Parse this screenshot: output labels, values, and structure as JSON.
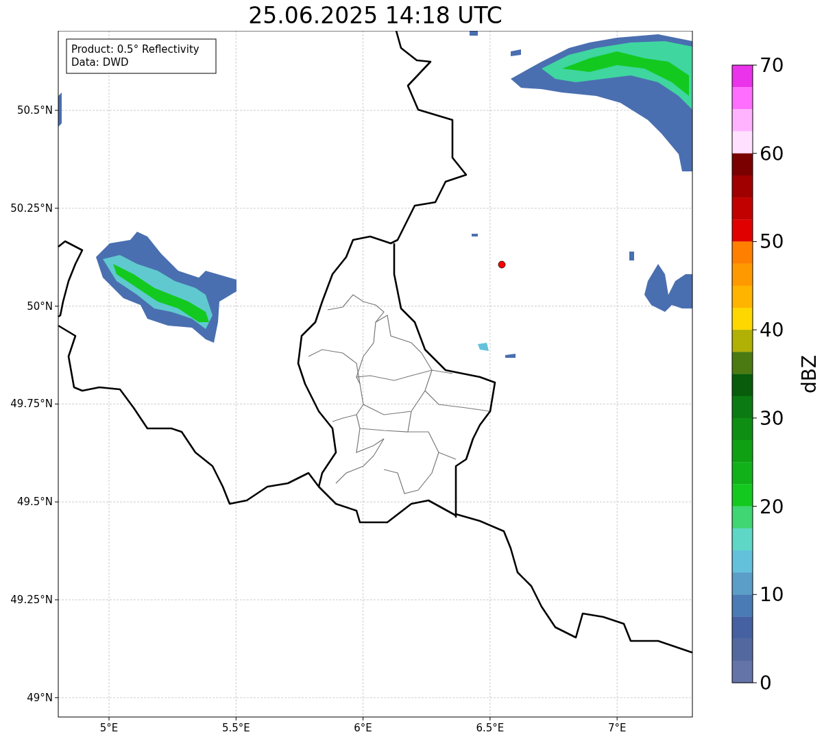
{
  "title": "25.06.2025 14:18 UTC",
  "info_box": {
    "lines": [
      "Product: 0.5° Reflectivity",
      "Data: DWD"
    ]
  },
  "x_ticks": [
    "5°E",
    "5.5°E",
    "6°E",
    "6.5°E",
    "7°E"
  ],
  "y_ticks": [
    "50.5°N",
    "50.25°N",
    "50°N",
    "49.75°N",
    "49.5°N",
    "49.25°N",
    "49°N"
  ],
  "colorbar": {
    "label": "dBZ",
    "ticks": [
      "70",
      "60",
      "50",
      "40",
      "30",
      "20",
      "10",
      "0"
    ],
    "bins": [
      {
        "color": "#ea33ea"
      },
      {
        "color": "#ff6eff"
      },
      {
        "color": "#ffb3ff"
      },
      {
        "color": "#ffe1ff"
      },
      {
        "color": "#7a0000"
      },
      {
        "color": "#a00000"
      },
      {
        "color": "#c10000"
      },
      {
        "color": "#e00000"
      },
      {
        "color": "#ff7f00"
      },
      {
        "color": "#ff9900"
      },
      {
        "color": "#ffb400"
      },
      {
        "color": "#ffd700"
      },
      {
        "color": "#b0b005"
      },
      {
        "color": "#4c7a12"
      },
      {
        "color": "#085c0b"
      },
      {
        "color": "#0c7a12"
      },
      {
        "color": "#0e8e13"
      },
      {
        "color": "#10a014"
      },
      {
        "color": "#11b11a"
      },
      {
        "color": "#13c91f"
      },
      {
        "color": "#3fd673"
      },
      {
        "color": "#5fd7c7"
      },
      {
        "color": "#63c1dc"
      },
      {
        "color": "#5b9ec8"
      },
      {
        "color": "#4a7bb5"
      },
      {
        "color": "#4561a2"
      },
      {
        "color": "#5468a0"
      },
      {
        "color": "#6474a8"
      }
    ]
  }
}
